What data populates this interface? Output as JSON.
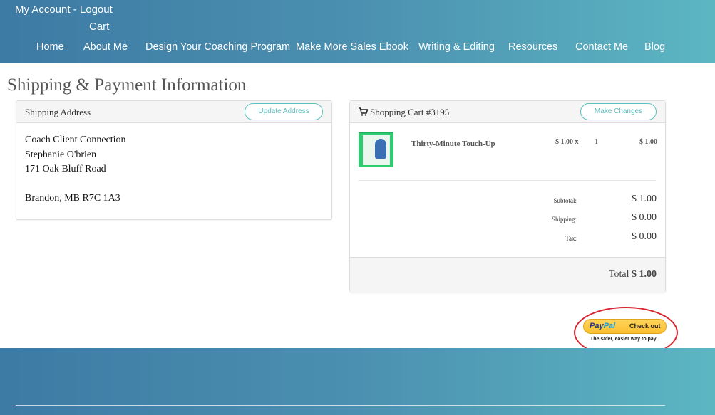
{
  "header": {
    "my_account": "My Account",
    "separator": " - ",
    "logout": "Logout",
    "cart": "Cart",
    "nav": [
      "Home",
      "About Me",
      "Design Your Coaching Program",
      "Make More Sales Ebook",
      "Writing & Editing",
      "Resources",
      "Contact Me",
      "Blog"
    ]
  },
  "page": {
    "title": "Shipping & Payment Information"
  },
  "shipping": {
    "heading": "Shipping Address",
    "update_label": "Update Address",
    "lines": [
      "Coach Client Connection",
      "Stephanie O'brien",
      "171 Oak Bluff Road",
      "",
      "Brandon, MB R7C 1A3"
    ]
  },
  "cart": {
    "heading": "Shopping Cart #3195",
    "change_label": "Make Changes",
    "item": {
      "name": "Thirty-Minute Touch-Up",
      "price": "$ 1.00 x",
      "qty": "1",
      "total": "$ 1.00"
    },
    "subtotal_label": "Subtotal:",
    "subtotal": "$ 1.00",
    "shipping_label": "Shipping:",
    "shipping": "$ 0.00",
    "tax_label": "Tax:",
    "tax": "$ 0.00",
    "total_label": "Total",
    "total": "$ 1.00"
  },
  "paypal": {
    "brand_pay": "Pay",
    "brand_pal": "Pal",
    "checkout": "Check out",
    "tagline": "The safer, easier way to pay"
  }
}
